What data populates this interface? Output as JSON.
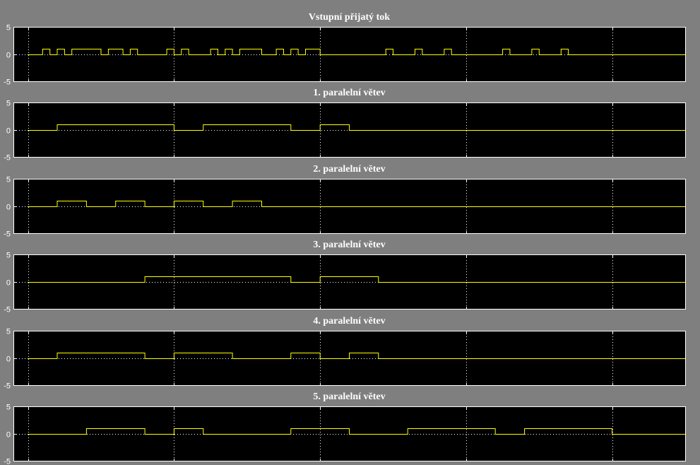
{
  "colors": {
    "background": "#7f7f7f",
    "axes": "#000000",
    "signal": "#ffff00",
    "text": "#ffffff"
  },
  "chart_data": [
    {
      "type": "line",
      "step": true,
      "grid": true,
      "title": "Vstupní přijatý tok",
      "ylim": [
        -5,
        5
      ],
      "yticks": [
        5,
        0,
        -5
      ],
      "xlim": [
        -0.5,
        22.5
      ],
      "x": [
        0,
        0.5,
        0.5,
        0.75,
        0.75,
        1.0,
        1.0,
        1.25,
        1.25,
        1.5,
        1.5,
        2.5,
        2.5,
        2.75,
        2.75,
        3.25,
        3.25,
        3.5,
        3.5,
        3.75,
        3.75,
        4.75,
        4.75,
        5.0,
        5.0,
        5.25,
        5.25,
        5.5,
        5.5,
        6.25,
        6.25,
        6.5,
        6.5,
        6.75,
        6.75,
        7.0,
        7.0,
        7.25,
        7.25,
        8.0,
        8.0,
        8.5,
        8.5,
        8.75,
        8.75,
        9.0,
        9.0,
        9.25,
        9.25,
        9.5,
        9.5,
        10.0,
        10.0,
        12.25,
        12.25,
        12.5,
        12.5,
        13.25,
        13.25,
        13.5,
        13.5,
        14.25,
        14.25,
        14.5,
        14.5,
        16.25,
        16.25,
        16.5,
        16.5,
        17.25,
        17.25,
        17.5,
        17.5,
        18.25,
        18.25,
        18.5,
        18.5,
        22.5
      ],
      "y": [
        0,
        0,
        1,
        1,
        0,
        0,
        1,
        1,
        0,
        0,
        1,
        1,
        0,
        0,
        1,
        1,
        0,
        0,
        1,
        1,
        0,
        0,
        1,
        1,
        0,
        0,
        1,
        1,
        0,
        0,
        1,
        1,
        0,
        0,
        1,
        1,
        0,
        0,
        1,
        1,
        0,
        0,
        1,
        1,
        0,
        0,
        1,
        1,
        0,
        0,
        1,
        1,
        0,
        0,
        1,
        1,
        0,
        0,
        1,
        1,
        0,
        0,
        1,
        1,
        0,
        0,
        1,
        1,
        0,
        0,
        1,
        1,
        0,
        0,
        1,
        1,
        0,
        0
      ]
    },
    {
      "type": "line",
      "step": true,
      "grid": true,
      "title": "1. paralelní větev",
      "ylim": [
        -5,
        5
      ],
      "yticks": [
        5,
        0,
        -5
      ],
      "xlim": [
        -0.5,
        22.5
      ],
      "x": [
        0,
        1.0,
        1.0,
        5.0,
        5.0,
        6.0,
        6.0,
        9.0,
        9.0,
        10.0,
        10.0,
        11.0,
        11.0,
        22.5
      ],
      "y": [
        0,
        0,
        1,
        1,
        0,
        0,
        1,
        1,
        0,
        0,
        1,
        1,
        0,
        0
      ]
    },
    {
      "type": "line",
      "step": true,
      "grid": true,
      "title": "2. paralelní větev",
      "ylim": [
        -5,
        5
      ],
      "yticks": [
        5,
        0,
        -5
      ],
      "xlim": [
        -0.5,
        22.5
      ],
      "x": [
        0,
        1.0,
        1.0,
        2.0,
        2.0,
        3.0,
        3.0,
        4.0,
        4.0,
        5.0,
        5.0,
        6.0,
        6.0,
        7.0,
        7.0,
        8.0,
        8.0,
        22.5
      ],
      "y": [
        0,
        0,
        1,
        1,
        0,
        0,
        1,
        1,
        0,
        0,
        1,
        1,
        0,
        0,
        1,
        1,
        0,
        0
      ]
    },
    {
      "type": "line",
      "step": true,
      "grid": true,
      "title": "3. paralelní větev",
      "ylim": [
        -5,
        5
      ],
      "yticks": [
        5,
        0,
        -5
      ],
      "xlim": [
        -0.5,
        22.5
      ],
      "x": [
        0,
        4.0,
        4.0,
        9.0,
        9.0,
        10.0,
        10.0,
        12.0,
        12.0,
        22.5
      ],
      "y": [
        0,
        0,
        1,
        1,
        0,
        0,
        1,
        1,
        0,
        0
      ]
    },
    {
      "type": "line",
      "step": true,
      "grid": true,
      "title": "4. paralelní větev",
      "ylim": [
        -5,
        5
      ],
      "yticks": [
        5,
        0,
        -5
      ],
      "xlim": [
        -0.5,
        22.5
      ],
      "x": [
        0,
        1.0,
        1.0,
        4.0,
        4.0,
        5.0,
        5.0,
        7.0,
        7.0,
        9.0,
        9.0,
        10.0,
        10.0,
        11.0,
        11.0,
        12.0,
        12.0,
        22.5
      ],
      "y": [
        0,
        0,
        1,
        1,
        0,
        0,
        1,
        1,
        0,
        0,
        1,
        1,
        0,
        0,
        1,
        1,
        0,
        0
      ]
    },
    {
      "type": "line",
      "step": true,
      "grid": true,
      "title": "5. paralelní větev",
      "ylim": [
        -5,
        5
      ],
      "yticks": [
        5,
        0,
        -5
      ],
      "xlim": [
        -0.5,
        22.5
      ],
      "x": [
        0,
        2.0,
        2.0,
        4.0,
        4.0,
        5.0,
        5.0,
        6.0,
        6.0,
        9.0,
        9.0,
        11.0,
        11.0,
        13.0,
        13.0,
        16.0,
        16.0,
        17.0,
        17.0,
        20.0,
        20.0,
        22.5
      ],
      "y": [
        0,
        0,
        1,
        1,
        0,
        0,
        1,
        1,
        0,
        0,
        1,
        1,
        0,
        0,
        1,
        1,
        0,
        0,
        1,
        1,
        0,
        0
      ]
    }
  ]
}
